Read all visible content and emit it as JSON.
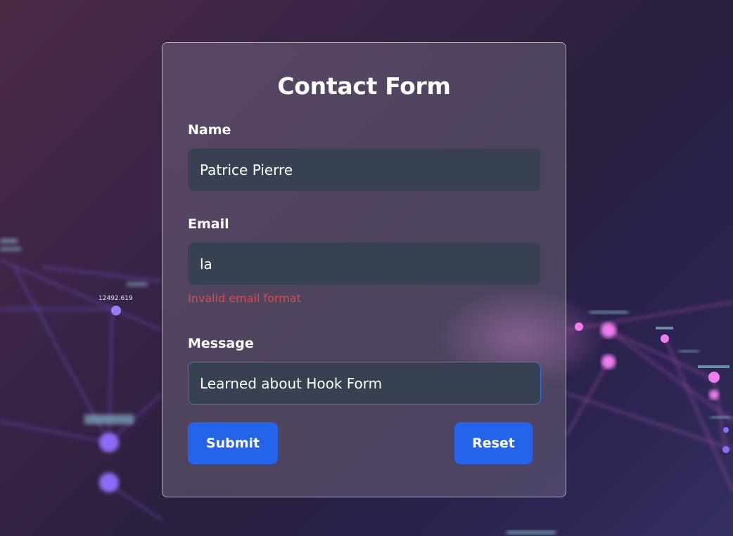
{
  "form": {
    "title": "Contact Form",
    "fields": {
      "name": {
        "label": "Name",
        "value": "Patrice Pierre"
      },
      "email": {
        "label": "Email",
        "value": "la",
        "error": "Invalid email format"
      },
      "message": {
        "label": "Message",
        "value": "Learned about Hook Form"
      }
    },
    "buttons": {
      "submit_label": "Submit",
      "reset_label": "Reset"
    }
  },
  "background": {
    "node_labels": [
      "12492.619"
    ]
  },
  "colors": {
    "button": "#2563eb",
    "input_bg": "#374151",
    "error": "#e04848",
    "focus_border": "#3b6fd8"
  }
}
